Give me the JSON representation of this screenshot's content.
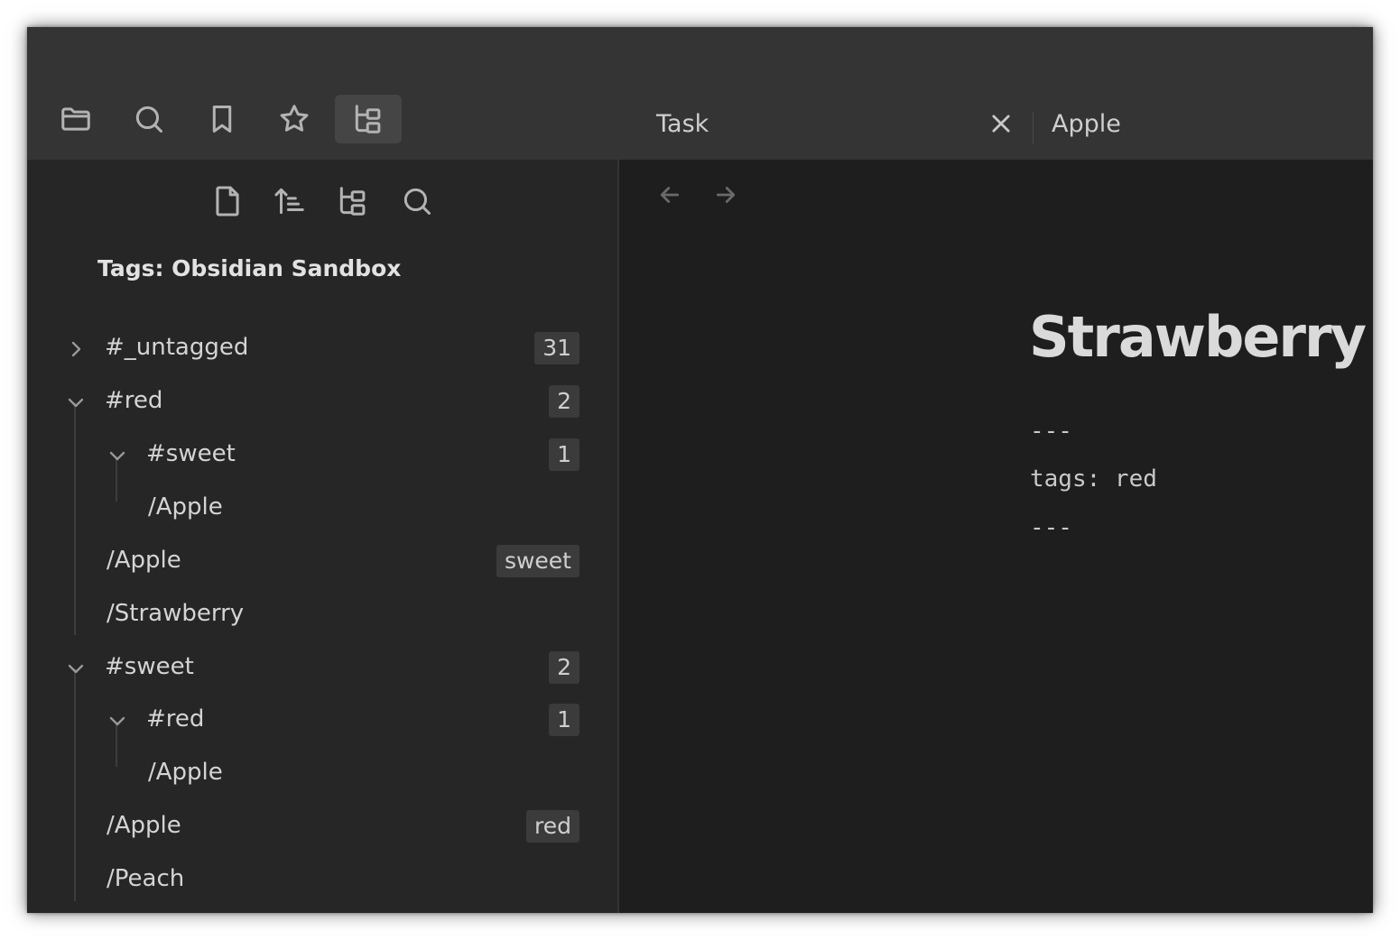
{
  "ribbon": {
    "buttons": [
      {
        "icon": "folder-icon"
      },
      {
        "icon": "search-icon"
      },
      {
        "icon": "bookmark-icon"
      },
      {
        "icon": "star-icon"
      },
      {
        "icon": "tag-tree-icon",
        "active": true
      }
    ]
  },
  "tabs": [
    {
      "label": "Task",
      "closable": true
    },
    {
      "label": "Apple"
    }
  ],
  "sidebar": {
    "toolbar": [
      "new-note-icon",
      "sort-icon",
      "tag-tree-icon",
      "search-icon"
    ],
    "title": "Tags: Obsidian Sandbox",
    "rows": [
      {
        "text": "#_untagged",
        "badge": "31",
        "chevron": "right"
      },
      {
        "text": "#red",
        "badge": "2",
        "chevron": "down"
      },
      {
        "text": "#sweet",
        "badge": "1",
        "chevron": "down"
      },
      {
        "text": "/Apple"
      },
      {
        "text": "/Apple",
        "badge": "sweet"
      },
      {
        "text": "/Strawberry"
      },
      {
        "text": "#sweet",
        "badge": "2",
        "chevron": "down"
      },
      {
        "text": "#red",
        "badge": "1",
        "chevron": "down"
      },
      {
        "text": "/Apple"
      },
      {
        "text": "/Apple",
        "badge": "red"
      },
      {
        "text": "/Peach"
      }
    ]
  },
  "editor": {
    "title": "Strawberry",
    "frontmatter": [
      "---",
      "tags: red",
      "---"
    ]
  },
  "colors": {
    "titlebar": "#343434",
    "sidebar": "#262626",
    "editor": "#1e1e1e",
    "badge": "#3b3b3b",
    "text": "#d4d4d4"
  }
}
